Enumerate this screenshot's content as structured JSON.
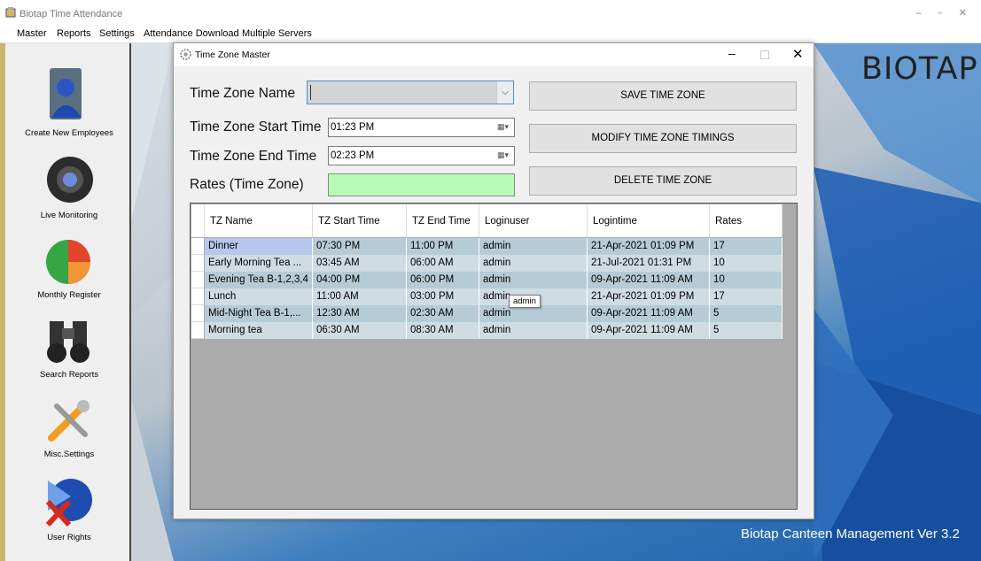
{
  "app": {
    "title": "Biotap Time Attendance",
    "window_controls": [
      "–",
      "▫",
      "✕"
    ]
  },
  "menu": [
    "Master",
    "Reports",
    "Settings",
    "Attendance Download",
    "Multiple Servers"
  ],
  "sidebar": {
    "items": [
      {
        "label": "Create New Employees",
        "icon": "employee-icon"
      },
      {
        "label": "Live Monitoring",
        "icon": "camera-icon"
      },
      {
        "label": "Monthly Register",
        "icon": "pie-chart-icon"
      },
      {
        "label": "Search Reports",
        "icon": "binoculars-icon"
      },
      {
        "label": "Misc.Settings",
        "icon": "tools-icon"
      },
      {
        "label": "User Rights",
        "icon": "user-rights-icon"
      }
    ]
  },
  "brand": {
    "logo": "BIOTAP",
    "version": "Biotap Canteen Management Ver 3.2"
  },
  "dialog": {
    "title": "Time Zone Master",
    "fields": {
      "name_label": "Time Zone Name",
      "name_value": "",
      "start_label": "Time Zone Start Time",
      "start_value": "01:23 PM",
      "end_label": "Time Zone End Time",
      "end_value": "02:23 PM",
      "rates_label": "Rates (Time Zone)",
      "rates_value": ""
    },
    "buttons": {
      "save": "SAVE TIME ZONE",
      "modify": "MODIFY TIME ZONE TIMINGS",
      "delete": "DELETE TIME ZONE"
    },
    "grid": {
      "columns": [
        "TZ Name",
        "TZ Start Time",
        "TZ End Time",
        "Loginuser",
        "Logintime",
        "Rates"
      ],
      "rows": [
        [
          "Dinner",
          "07:30 PM",
          "11:00 PM",
          "admin",
          "21-Apr-2021 01:09 PM",
          "17"
        ],
        [
          "Early Morning Tea ...",
          "03:45 AM",
          "06:00 AM",
          "admin",
          "21-Jul-2021 01:31 PM",
          "10"
        ],
        [
          "Evening Tea B-1,2,3,4",
          "04:00 PM",
          "06:00 PM",
          "admin",
          "09-Apr-2021 11:09 AM",
          "10"
        ],
        [
          "Lunch",
          "11:00 AM",
          "03:00 PM",
          "admin",
          "21-Apr-2021 01:09 PM",
          "17"
        ],
        [
          "Mid-Night Tea B-1,...",
          "12:30 AM",
          "02:30 AM",
          "admin",
          "09-Apr-2021 11:09 AM",
          "5"
        ],
        [
          "Morning tea",
          "06:30 AM",
          "08:30 AM",
          "admin",
          "09-Apr-2021 11:09 AM",
          "5"
        ]
      ],
      "tooltip": "admin"
    }
  },
  "colors": {
    "row_a": "#b5ccd6",
    "row_b": "#cfdde3",
    "selected": "#b4c8ec",
    "rates_bg": "#b7fbb7"
  }
}
